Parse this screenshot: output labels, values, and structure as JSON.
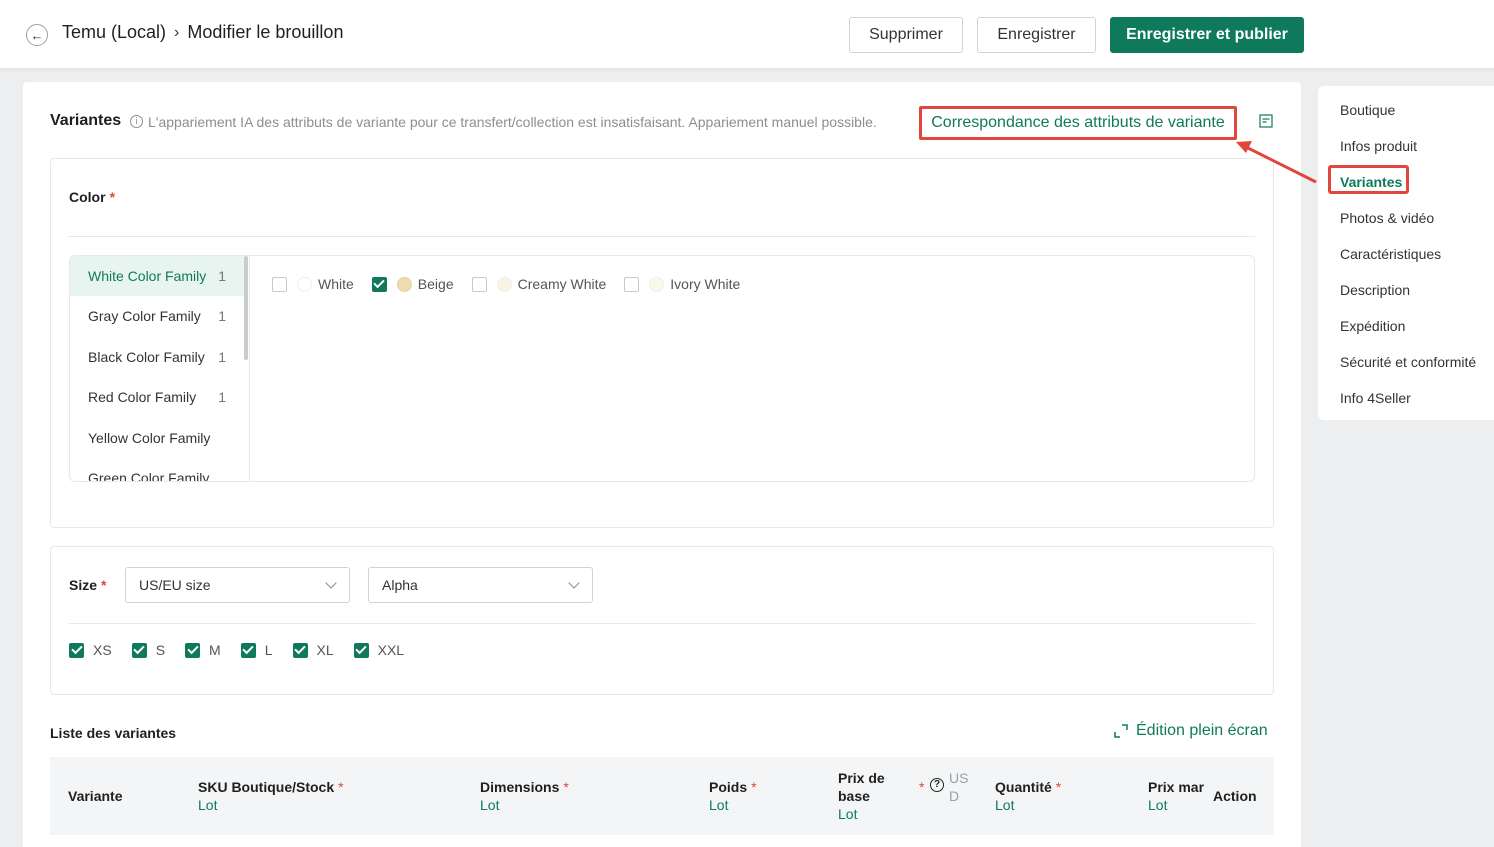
{
  "header": {
    "breadcrumb_store": "Temu (Local)",
    "breadcrumb_page": "Modifier le brouillon",
    "delete_label": "Supprimer",
    "save_label": "Enregistrer",
    "publish_label": "Enregistrer et publier"
  },
  "variants": {
    "title": "Variantes",
    "info_text": "L'appariement IA des attributs de variante pour ce transfert/collection est insatisfaisant. Appariement manuel possible.",
    "mapping_link": "Correspondance des attributs de variante",
    "color": {
      "label": "Color",
      "families": [
        {
          "name": "White Color Family",
          "count": "1",
          "active": true
        },
        {
          "name": "Gray Color Family",
          "count": "1"
        },
        {
          "name": "Black Color Family",
          "count": "1"
        },
        {
          "name": "Red Color Family",
          "count": "1"
        },
        {
          "name": "Yellow Color Family",
          "count": ""
        },
        {
          "name": "Green Color Family",
          "count": ""
        }
      ],
      "swatches": [
        {
          "name": "White",
          "checked": false,
          "color": "#ffffff"
        },
        {
          "name": "Beige",
          "checked": true,
          "color": "#eddcad"
        },
        {
          "name": "Creamy White",
          "checked": false,
          "color": "#fbf4e3"
        },
        {
          "name": "Ivory White",
          "checked": false,
          "color": "#fcf8e8"
        }
      ]
    },
    "size": {
      "label": "Size",
      "system_select": "US/EU size",
      "type_select": "Alpha",
      "options": [
        "XS",
        "S",
        "M",
        "L",
        "XL",
        "XXL"
      ]
    },
    "list": {
      "title": "Liste des variantes",
      "fullscreen": "Édition plein écran",
      "columns": {
        "variant": "Variante",
        "sku": "SKU Boutique/Stock",
        "dimensions": "Dimensions",
        "weight": "Poids",
        "base_price_1": "Prix de",
        "base_price_2": "base",
        "currency_1": "US",
        "currency_2": "D",
        "quantity": "Quantité",
        "market_price": "Prix mar",
        "action": "Action",
        "lot": "Lot"
      }
    }
  },
  "sidenav": {
    "items": [
      "Boutique",
      "Infos produit",
      "Variantes",
      "Photos & vidéo",
      "Caractéristiques",
      "Description",
      "Expédition",
      "Sécurité et conformité",
      "Info 4Seller"
    ]
  },
  "colors": {
    "brand": "#0e7a5b",
    "highlight": "#e0463b"
  }
}
